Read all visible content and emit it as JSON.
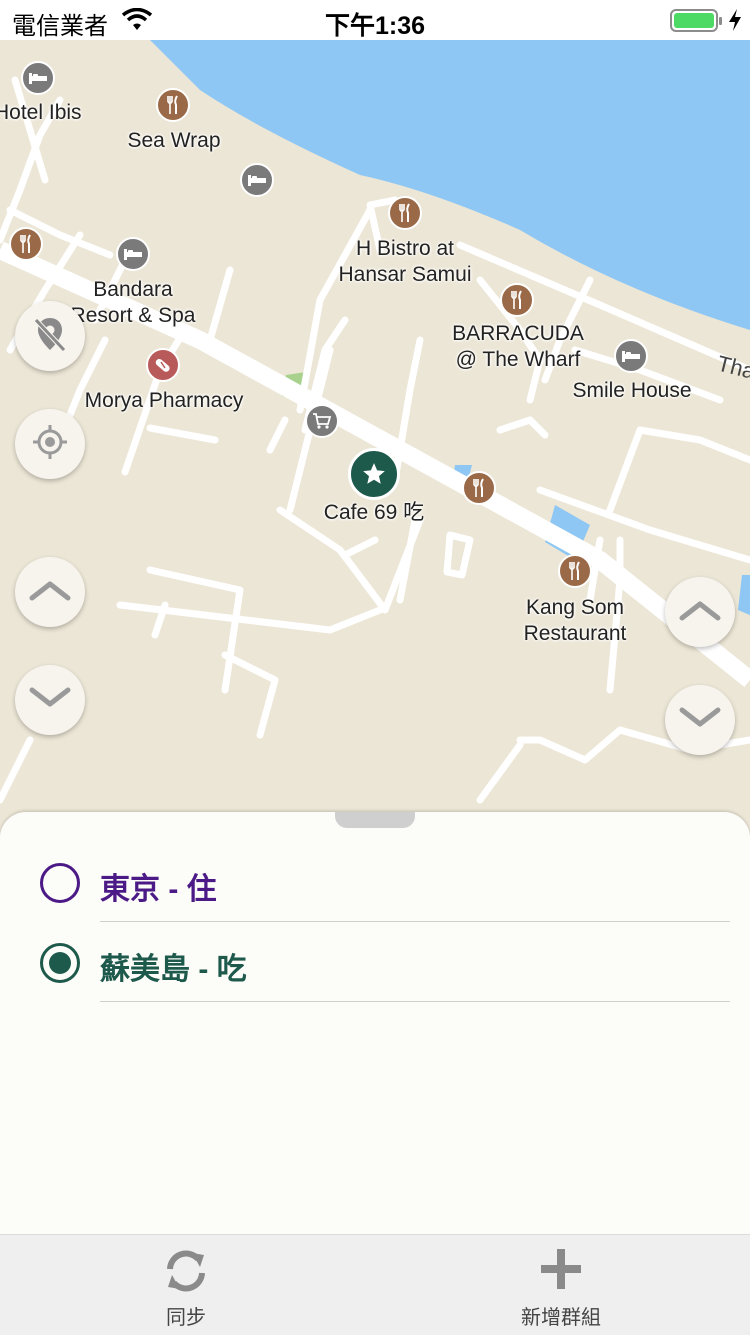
{
  "status_bar": {
    "carrier": "電信業者",
    "time": "下午1:36"
  },
  "map": {
    "pois": [
      {
        "id": "hotel-ibis",
        "label": "Hotel Ibis",
        "icon": "bed-icon",
        "color": "#7a7a7a"
      },
      {
        "id": "sea-wrap",
        "label": "Sea Wrap",
        "icon": "fork-knife-icon",
        "color": "#9a6a48"
      },
      {
        "id": "hotel-unnamed",
        "label": "",
        "icon": "bed-icon",
        "color": "#7a7a7a"
      },
      {
        "id": "h-bistro",
        "label": "H Bistro at\nHansar Samui",
        "icon": "fork-knife-icon",
        "color": "#9a6a48"
      },
      {
        "id": "restaurant-left",
        "label": "",
        "icon": "fork-knife-icon",
        "color": "#9a6a48"
      },
      {
        "id": "bandara",
        "label": "Bandara\nResort & Spa",
        "icon": "bed-icon",
        "color": "#7a7a7a"
      },
      {
        "id": "barracuda",
        "label": "BARRACUDA\n@ The Wharf",
        "icon": "fork-knife-icon",
        "color": "#9a6a48"
      },
      {
        "id": "smile-house",
        "label": "Smile House",
        "icon": "bed-icon",
        "color": "#7a7a7a"
      },
      {
        "id": "morya",
        "label": "Morya Pharmacy",
        "icon": "pill-icon",
        "color": "#b85a5a"
      },
      {
        "id": "shop",
        "label": "",
        "icon": "cart-icon",
        "color": "#7a7a7a"
      },
      {
        "id": "cafe-69",
        "label": "Cafe 69 吃",
        "icon": "star-icon",
        "color": "#1e5a4c"
      },
      {
        "id": "restaurant-mid",
        "label": "",
        "icon": "fork-knife-icon",
        "color": "#9a6a48"
      },
      {
        "id": "kang-som",
        "label": "Kang Som\nRestaurant",
        "icon": "fork-knife-icon",
        "color": "#9a6a48"
      }
    ],
    "road_label": "Tha"
  },
  "groups": [
    {
      "label": "東京 - 住",
      "selected": false,
      "color": "#4b1a86"
    },
    {
      "label": "蘇美島 - 吃",
      "selected": true,
      "color": "#1e5a4c"
    }
  ],
  "tab_bar": {
    "sync_label": "同步",
    "add_group_label": "新增群組"
  }
}
